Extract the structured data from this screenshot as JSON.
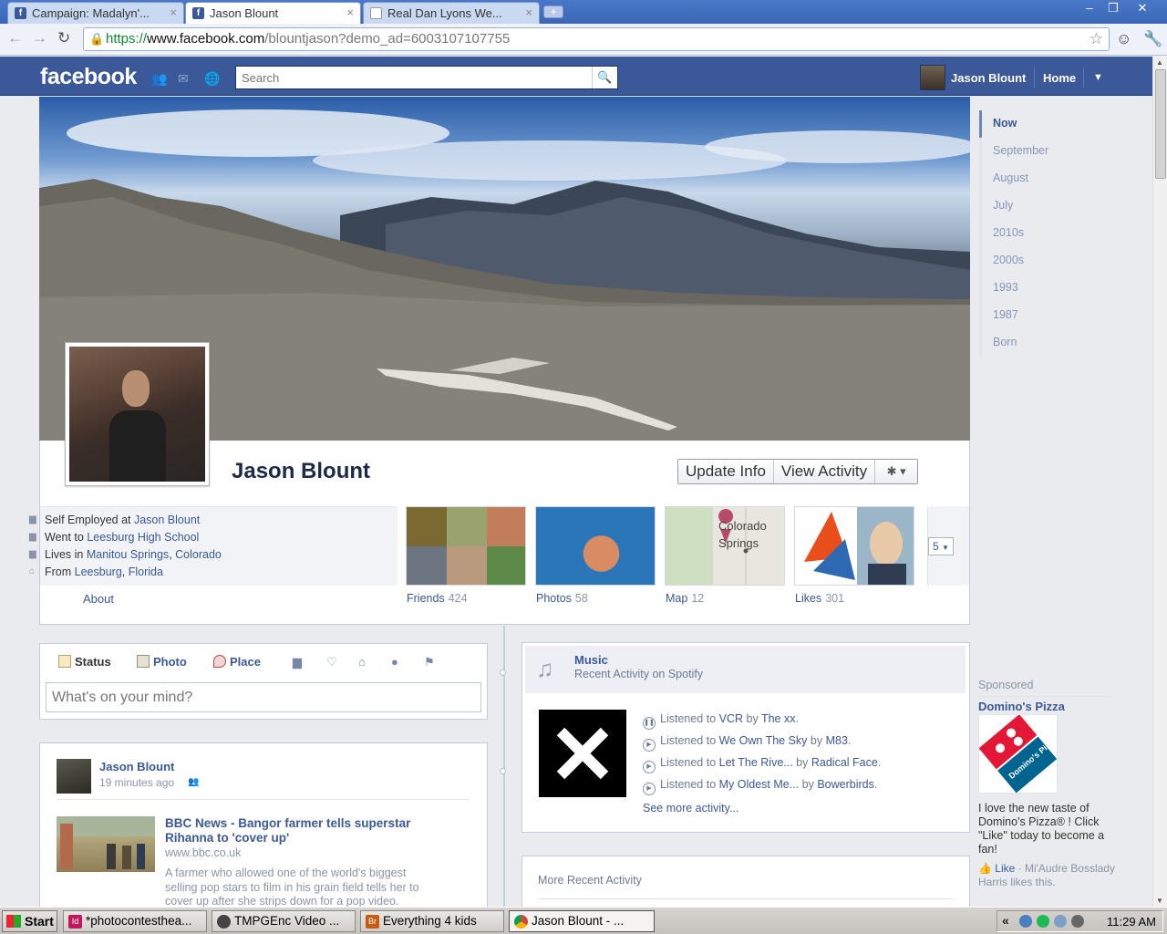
{
  "browser": {
    "tabs": [
      {
        "label": "Campaign: Madalyn'...",
        "active": false
      },
      {
        "label": "Jason Blount",
        "active": true
      },
      {
        "label": "Real Dan Lyons We...",
        "active": false
      }
    ],
    "url": {
      "scheme": "https://",
      "host": "www.facebook.com",
      "path": "/blountjason?demo_ad=6003107107755"
    }
  },
  "fb_bar": {
    "logo": "facebook",
    "search_placeholder": "Search",
    "user_name": "Jason Blount",
    "home": "Home"
  },
  "profile": {
    "name": "Jason Blount",
    "actions": {
      "update_info": "Update Info",
      "view_activity": "View Activity"
    },
    "info": [
      {
        "prefix": "Self Employed at ",
        "link": "Jason Blount",
        "mid": "",
        "link2": ""
      },
      {
        "prefix": "Went to ",
        "link": "Leesburg High School",
        "mid": "",
        "link2": ""
      },
      {
        "prefix": "Lives in ",
        "link": "Manitou Springs",
        "mid": ", ",
        "link2": "Colorado"
      },
      {
        "prefix": "From ",
        "link": "Leesburg",
        "mid": ", ",
        "link2": "Florida"
      }
    ],
    "about": "About",
    "apps": [
      {
        "label": "Friends",
        "count": "424"
      },
      {
        "label": "Photos",
        "count": "58"
      },
      {
        "label": "Map",
        "count": "12"
      },
      {
        "label": "Likes",
        "count": "301"
      }
    ],
    "map_text": "Colorado Springs",
    "more_apps_count": "5"
  },
  "timeline_nav": [
    "Now",
    "September",
    "August",
    "July",
    "2010s",
    "2000s",
    "1993",
    "1987",
    "Born"
  ],
  "composer": {
    "tabs": [
      "Status",
      "Photo",
      "Place"
    ],
    "placeholder": "What's on your mind?"
  },
  "story": {
    "author": "Jason Blount",
    "time": "19 minutes ago",
    "title": "BBC News - Bangor farmer tells superstar Rihanna to 'cover up'",
    "domain": "www.bbc.co.uk",
    "summary": "A farmer who allowed one of the world's biggest selling pop stars to film in his grain field tells her to cover up after she strips down for a pop video."
  },
  "music": {
    "title": "Music",
    "subtitle": "Recent Activity on Spotify",
    "plays": [
      {
        "track": "VCR",
        "artist": "The xx"
      },
      {
        "track": "We Own The Sky",
        "artist": "M83"
      },
      {
        "track": "Let The Rive...",
        "artist": "Radical Face"
      },
      {
        "track": "My Oldest Me...",
        "artist": "Bowerbirds"
      }
    ],
    "listened_to": "Listened to ",
    "by": " by ",
    "see_more": "See more activity..."
  },
  "recent": {
    "title": "More Recent Activity"
  },
  "sponsored": {
    "label": "Sponsored",
    "ad_title": "Domino's Pizza",
    "ad_logo_text": "Domino's Pizza",
    "ad_body": "I love the new taste of Domino's Pizza® ! Click \"Like\" today to become a fan!",
    "like": "Like",
    "like_by": " · Mi'Audre Bosslady Harris likes this."
  },
  "taskbar": {
    "start": "Start",
    "tasks": [
      {
        "label": "*photocontesthea...",
        "icon_text": "Id",
        "color": "#c2185b"
      },
      {
        "label": "TMPGEnc Video ...",
        "icon_text": "",
        "color": "#444"
      },
      {
        "label": "Everything 4 kids",
        "icon_text": "Br",
        "color": "#c75b12"
      },
      {
        "label": "Jason Blount - ...",
        "icon_text": "",
        "color": "#4a8a2a"
      }
    ],
    "clock": "11:29 AM"
  },
  "colors": {
    "fb_blue": "#3b5998",
    "link": "#3b5998",
    "chrome_blue": "#4a78c8"
  }
}
